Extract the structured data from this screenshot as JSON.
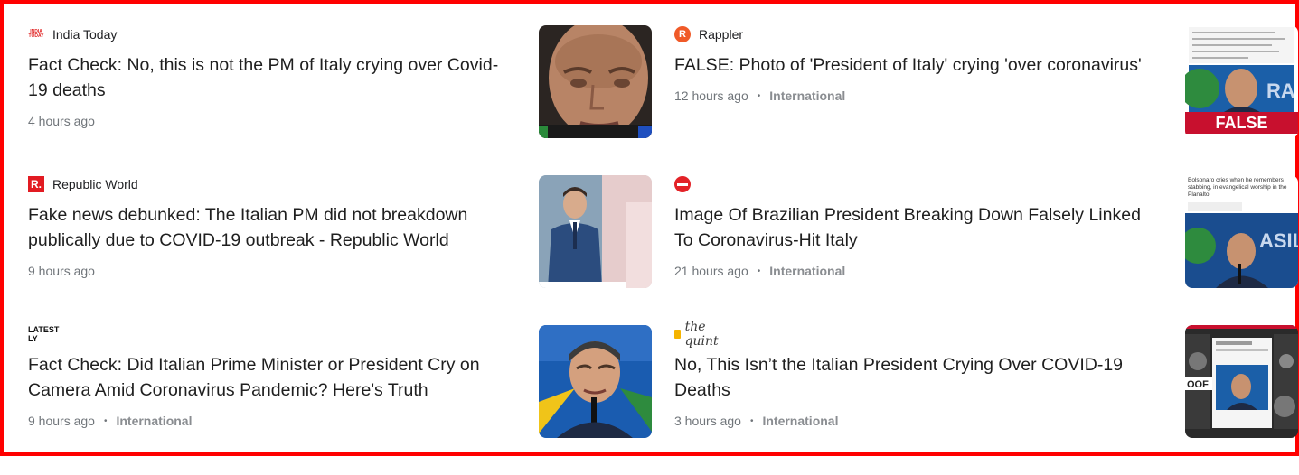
{
  "articles": [
    {
      "source": "India Today",
      "logo_text": "INDIA TODAY",
      "headline": "Fact Check: No, this is not the PM of Italy crying over Covid-19 deaths",
      "time": "4 hours ago",
      "category": ""
    },
    {
      "source": "Rappler",
      "logo_text": "R",
      "headline": "FALSE: Photo of 'President of Italy' crying 'over coronavirus'",
      "time": "12 hours ago",
      "category": "International",
      "thumb_badge": "FALSE"
    },
    {
      "source": "Republic World",
      "logo_text": "R.",
      "headline": "Fake news debunked: The Italian PM did not breakdown publically due to COVID-19 outbreak - Republic World",
      "time": "9 hours ago",
      "category": ""
    },
    {
      "source": "",
      "logo_text": "",
      "headline": "Image Of Brazilian President Breaking Down Falsely Linked To Coronavirus-Hit Italy",
      "time": "21 hours ago",
      "category": "International",
      "thumb_caption": "Bolsonaro cries when he remembers stabbing, in evangelical worship in the Planalto"
    },
    {
      "source": "",
      "logo_text": "LATEST LY",
      "headline": "Fact Check: Did Italian Prime Minister or President Cry on Camera Amid Coronavirus Pandemic? Here's Truth",
      "time": "9 hours ago",
      "category": "International"
    },
    {
      "source": "",
      "logo_text": "the quint",
      "headline": "No, This Isn’t the Italian President Crying Over COVID-19 Deaths",
      "time": "3 hours ago",
      "category": "International"
    }
  ],
  "colors": {
    "frame": "#ff0000",
    "headline": "#1f1f1f",
    "meta": "#70757a",
    "false_badge": "#c8102e"
  },
  "separator": "•"
}
